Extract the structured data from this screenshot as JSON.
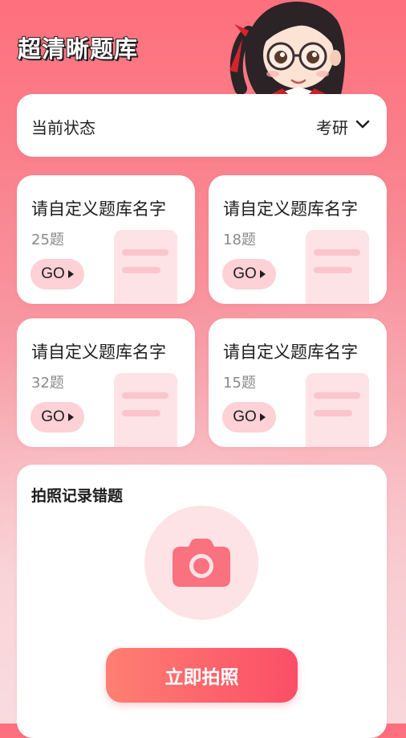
{
  "header": {
    "title": "超清晰题库",
    "mascot_icon": "student-girl-avatar"
  },
  "status": {
    "label": "当前状态",
    "value": "考研",
    "dropdown_icon": "chevron-down-icon"
  },
  "banks": [
    {
      "name": "请自定义题库名字",
      "count": "25题",
      "go_label": "GO"
    },
    {
      "name": "请自定义题库名字",
      "count": "18题",
      "go_label": "GO"
    },
    {
      "name": "请自定义题库名字",
      "count": "32题",
      "go_label": "GO"
    },
    {
      "name": "请自定义题库名字",
      "count": "15题",
      "go_label": "GO"
    }
  ],
  "photo": {
    "title": "拍照记录错题",
    "camera_icon": "camera-icon",
    "button_label": "立即拍照"
  },
  "colors": {
    "accent": "#fb4e66",
    "accent_light": "#ff7f72",
    "go_button_bg": "#fdd1d5",
    "camera_bg": "#fde3e5",
    "camera_icon": "#fa7180"
  }
}
